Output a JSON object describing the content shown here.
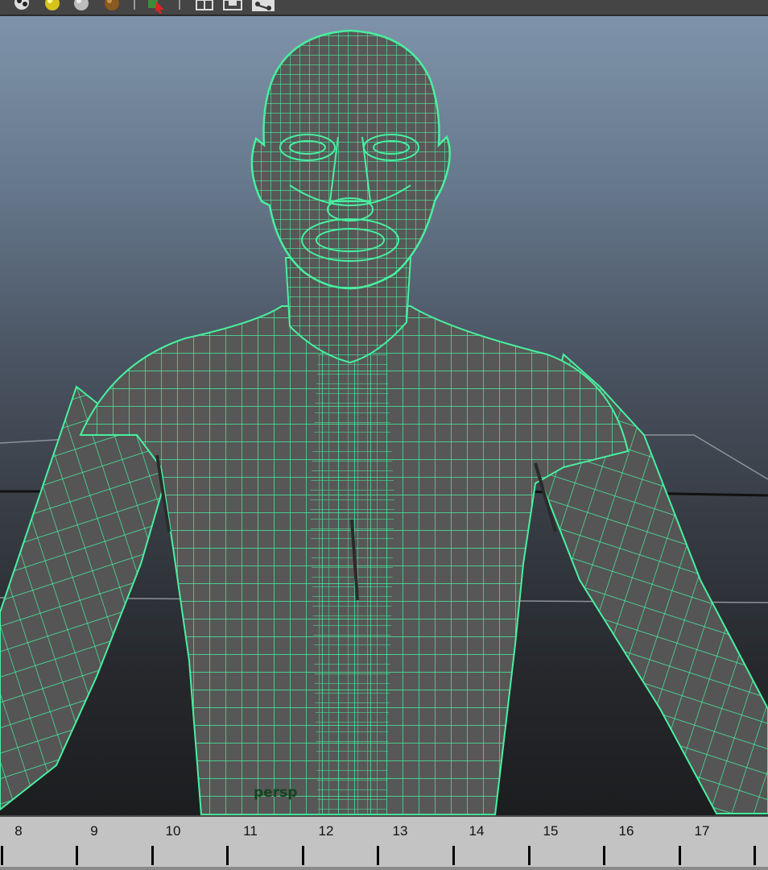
{
  "toolbar": {
    "buttons": [
      {
        "name": "shading-ball-icon"
      },
      {
        "name": "default-light-icon"
      },
      {
        "name": "all-lights-icon"
      },
      {
        "name": "shadows-ball-icon"
      },
      {
        "name": "select-camera-icon"
      },
      {
        "name": "isolate-select-icon"
      },
      {
        "name": "xray-icon"
      },
      {
        "name": "xray-joints-icon"
      }
    ]
  },
  "viewport": {
    "camera_label": "persp",
    "wireframe_color": "#48f0a0",
    "mesh_shade_color": "#555555"
  },
  "timeline": {
    "frames": [
      "8",
      "9",
      "10",
      "11",
      "12",
      "13",
      "14",
      "15",
      "16",
      "17"
    ]
  }
}
